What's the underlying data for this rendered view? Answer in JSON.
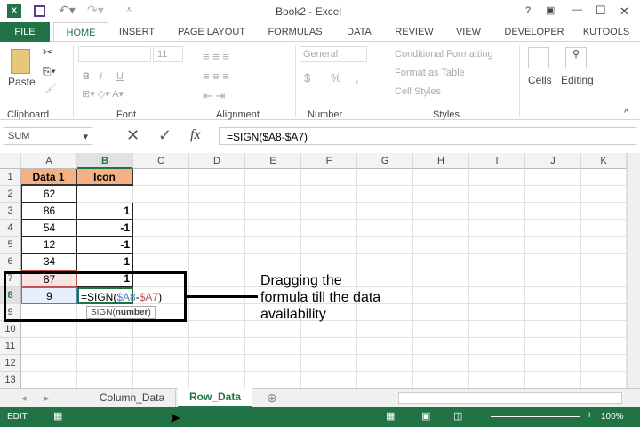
{
  "title": "Book2 - Excel",
  "window_controls": [
    "?",
    "▣",
    "—",
    "☐",
    "✕"
  ],
  "tabs": [
    "FILE",
    "HOME",
    "INSERT",
    "PAGE LAYOUT",
    "FORMULAS",
    "DATA",
    "REVIEW",
    "VIEW",
    "DEVELOPER",
    "KUTOOLS"
  ],
  "ribbon": {
    "paste": "Paste",
    "clipboard": "Clipboard",
    "font_size": "11",
    "font": "Font",
    "alignment": "Alignment",
    "number_format": "General",
    "number": "Number",
    "cond_format": "Conditional Formatting",
    "format_table": "Format as Table",
    "cell_styles": "Cell Styles",
    "styles": "Styles",
    "cells": "Cells",
    "editing": "Editing",
    "bold": "B",
    "italic": "I",
    "underline": "U",
    "currency": "$",
    "percent": "%",
    "comma": ","
  },
  "formula_bar": {
    "name_box": "SUM",
    "cancel": "✕",
    "enter": "✓",
    "fx": "fx",
    "formula": "=SIGN($A8-$A7)"
  },
  "columns": [
    "A",
    "B",
    "C",
    "D",
    "E",
    "F",
    "G",
    "H",
    "I",
    "J",
    "K"
  ],
  "rows": [
    "1",
    "2",
    "3",
    "4",
    "5",
    "6",
    "7",
    "8",
    "9",
    "10",
    "11",
    "12",
    "13"
  ],
  "cells": {
    "A": [
      "Data 1",
      "62",
      "86",
      "54",
      "12",
      "34",
      "87",
      "9"
    ],
    "B": [
      "Icon",
      "",
      "1",
      "-1",
      "-1",
      "1",
      "1"
    ]
  },
  "editing_cell": {
    "prefix": "=SIGN(",
    "ref1": "$A8",
    "minus": "-",
    "ref2": "$A7",
    "suffix": ")"
  },
  "tooltip": {
    "fn": "SIGN(",
    "arg": "number",
    "close": ")"
  },
  "annotation": "Dragging the formula till the data availability",
  "sheet_tabs": [
    "Column_Data",
    "Row_Data"
  ],
  "active_sheet": "Row_Data",
  "status": {
    "mode": "EDIT",
    "zoom": "100%"
  },
  "colors": {
    "accent": "#217346",
    "header_fill": "#f4b183"
  }
}
